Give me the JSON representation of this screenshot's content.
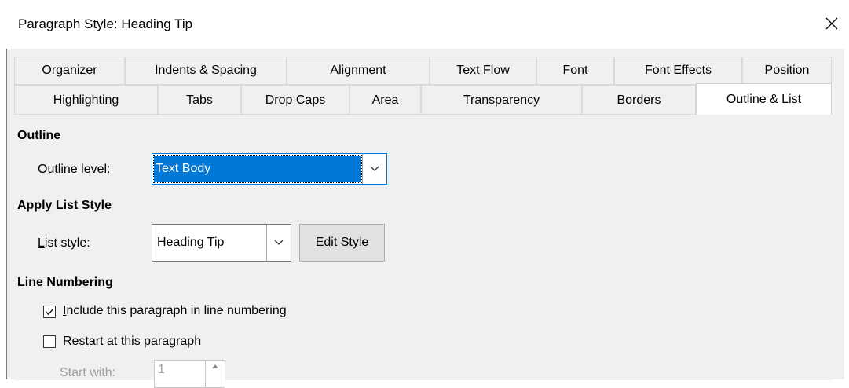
{
  "window": {
    "title": "Paragraph Style: Heading Tip",
    "close_icon": "close-icon"
  },
  "tabs": {
    "row1": [
      "Organizer",
      "Indents & Spacing",
      "Alignment",
      "Text Flow",
      "Font",
      "Font Effects",
      "Position"
    ],
    "row2": [
      "Highlighting",
      "Tabs",
      "Drop Caps",
      "Area",
      "Transparency",
      "Borders",
      "Outline & List"
    ],
    "active": "Outline & List"
  },
  "outline": {
    "heading": "Outline",
    "level_label_mnemonic": "O",
    "level_label_rest": "utline level:",
    "level_value": "Text Body"
  },
  "list_style": {
    "heading": "Apply List Style",
    "label_mnemonic": "L",
    "label_rest": "ist style:",
    "value": "Heading Tip",
    "edit_button_pre": "E",
    "edit_button_mnemonic": "d",
    "edit_button_post": "it Style"
  },
  "line_numbering": {
    "heading": "Line Numbering",
    "include_mnemonic": "I",
    "include_rest": "nclude this paragraph in line numbering",
    "include_checked": true,
    "restart_pre": "Res",
    "restart_mnemonic": "t",
    "restart_post": "art at this paragraph",
    "restart_checked": false,
    "start_with_label": "Start with:",
    "start_with_value": "1"
  },
  "colors": {
    "selection": "#0078d7",
    "panel_bg": "#f0f0f0"
  }
}
